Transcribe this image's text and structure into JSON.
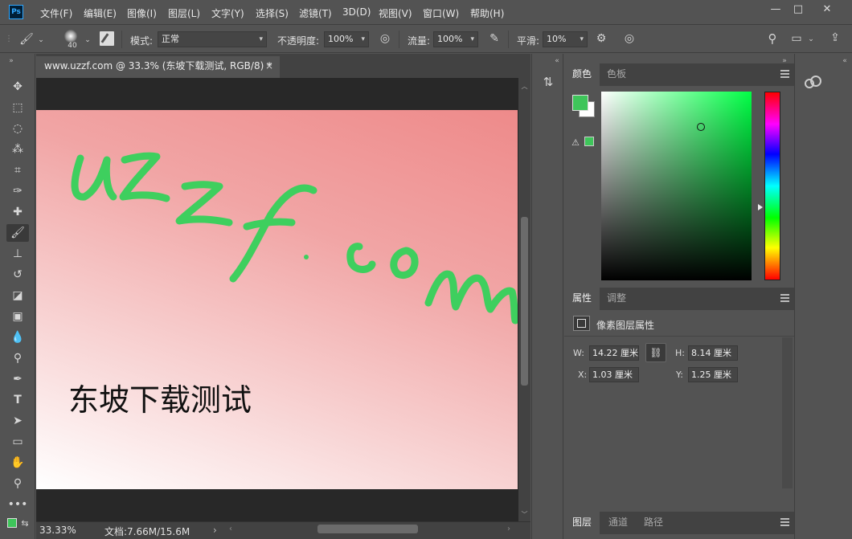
{
  "app": {
    "logo": "Ps"
  },
  "menu": [
    "文件(F)",
    "编辑(E)",
    "图像(I)",
    "图层(L)",
    "文字(Y)",
    "选择(S)",
    "滤镜(T)",
    "3D(D)",
    "视图(V)",
    "窗口(W)",
    "帮助(H)"
  ],
  "window_controls": {
    "minimize": "—",
    "maximize": "□",
    "close": "✕"
  },
  "options": {
    "brush_size": "40",
    "mode_label": "模式:",
    "mode_value": "正常",
    "opacity_label": "不透明度:",
    "opacity_value": "100%",
    "flow_label": "流量:",
    "flow_value": "100%",
    "smoothing_label": "平滑:",
    "smoothing_value": "10%"
  },
  "document": {
    "tab_title": "www.uzzf.com @ 33.3% (东坡下载测试, RGB/8) *",
    "close": "×",
    "canvas_handwriting": "uzzf.com",
    "canvas_text": "东坡下载测试",
    "handwriting_color": "#3ecf5e"
  },
  "status": {
    "zoom": "33.33%",
    "doc_size": "文档:7.66M/15.6M",
    "arrow": "›"
  },
  "panels": {
    "color_tabs": [
      "颜色",
      "色板"
    ],
    "foreground_color": "#3ec55a",
    "background_color": "#ffffff",
    "gamut_warning_color": "#3ec55a",
    "props_tabs": [
      "属性",
      "调整"
    ],
    "props_title": "像素图层属性",
    "w_label": "W:",
    "w_value": "14.22 厘米",
    "h_label": "H:",
    "h_value": "8.14 厘米",
    "x_label": "X:",
    "x_value": "1.03 厘米",
    "y_label": "Y:",
    "y_value": "1.25 厘米",
    "layers_tabs": [
      "图层",
      "通道",
      "路径"
    ]
  }
}
